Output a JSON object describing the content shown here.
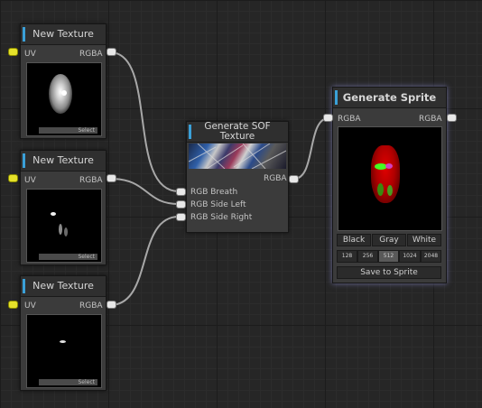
{
  "nodes": {
    "texture1": {
      "title": "New Texture",
      "input": "UV",
      "output": "RGBA",
      "select": "Select"
    },
    "texture2": {
      "title": "New Texture",
      "input": "UV",
      "output": "RGBA",
      "select": "Select"
    },
    "texture3": {
      "title": "New Texture",
      "input": "UV",
      "output": "RGBA",
      "select": "Select"
    },
    "sof": {
      "title": "Generate SOF Texture",
      "output": "RGBA",
      "inputs": [
        "RGB Breath",
        "RGB Side Left",
        "RGB Side Right"
      ]
    },
    "sprite": {
      "title": "Generate Sprite",
      "input": "RGBA",
      "output": "RGBA",
      "bg_buttons": [
        "Black",
        "Gray",
        "White"
      ],
      "sizes": [
        "128",
        "256",
        "512",
        "1024",
        "2048"
      ],
      "selected_size": "512",
      "save": "Save to Sprite"
    }
  },
  "colors": {
    "title_accent": "#3aa0d8",
    "uv_pin": "#e6e22a",
    "wire": "#a8a8a8",
    "canvas_bg": "#262626"
  }
}
